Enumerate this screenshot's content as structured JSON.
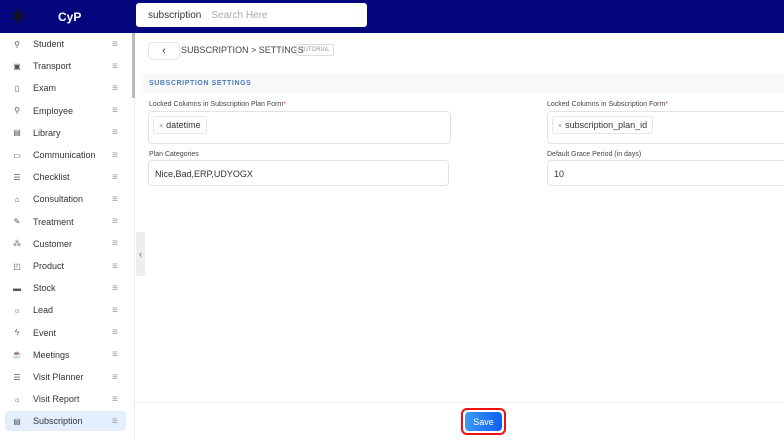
{
  "header": {
    "brand": "CyP",
    "search_value": "subscription",
    "search_placeholder": "Search Here"
  },
  "sidebar": {
    "items": [
      {
        "label": "Student",
        "icon": "user-icon"
      },
      {
        "label": "Transport",
        "icon": "bus-icon"
      },
      {
        "label": "Exam",
        "icon": "clipboard-icon"
      },
      {
        "label": "Employee",
        "icon": "user-icon"
      },
      {
        "label": "Library",
        "icon": "library-icon"
      },
      {
        "label": "Communication",
        "icon": "message-icon"
      },
      {
        "label": "Checklist",
        "icon": "list-icon"
      },
      {
        "label": "Consultation",
        "icon": "consultation-icon"
      },
      {
        "label": "Treatment",
        "icon": "syringe-icon"
      },
      {
        "label": "Customer",
        "icon": "customers-icon"
      },
      {
        "label": "Product",
        "icon": "bag-icon"
      },
      {
        "label": "Stock",
        "icon": "stock-icon"
      },
      {
        "label": "Lead",
        "icon": "bulb-icon"
      },
      {
        "label": "Event",
        "icon": "event-icon"
      },
      {
        "label": "Meetings",
        "icon": "coffee-icon"
      },
      {
        "label": "Visit Planner",
        "icon": "list-icon"
      },
      {
        "label": "Visit Report",
        "icon": "bulb-icon"
      },
      {
        "label": "Subscription",
        "icon": "card-icon",
        "active": true
      }
    ]
  },
  "page": {
    "breadcrumb": "SUBSCRIPTION > SETTINGS",
    "tutorial": "TUTORIAL",
    "section": "SUBSCRIPTION SETTINGS",
    "fields": {
      "plan_locked": {
        "label": "Locked Columns in Subscription Plan Form",
        "required": "*",
        "chips": [
          "datetime"
        ]
      },
      "sub_locked": {
        "label": "Locked Columns in Subscription Form",
        "required": "*",
        "chips": [
          "subscription_plan_id"
        ]
      },
      "plan_categories": {
        "label": "Plan Categories",
        "value": "Nice,Bad,ERP,UDYOGX"
      },
      "grace": {
        "label": "Default Grace Period (in days)",
        "value": "10"
      }
    }
  },
  "footer": {
    "save_label": "Save"
  },
  "colors": {
    "topbar": "#05057e",
    "accent": "#0d5ff0",
    "highlight": "#e11"
  }
}
